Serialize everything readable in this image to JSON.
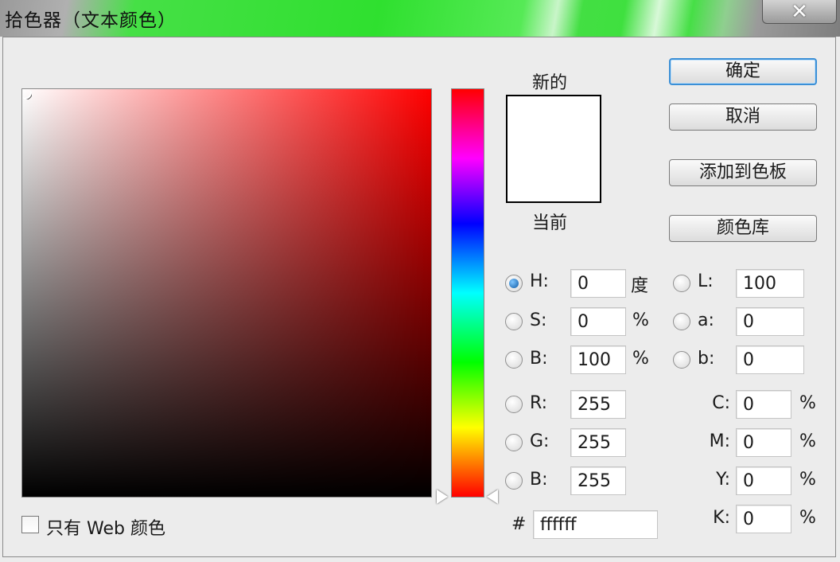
{
  "window": {
    "title": "拾色器（文本颜色）",
    "close_glyph": "✕"
  },
  "swatch": {
    "new_label": "新的",
    "current_label": "当前",
    "new_color": "#ffffff",
    "current_color": "#ffffff"
  },
  "buttons": {
    "ok": "确定",
    "cancel": "取消",
    "add_to_swatches": "添加到色板",
    "color_libraries": "颜色库"
  },
  "hsb": {
    "h": {
      "label": "H:",
      "value": "0",
      "unit": "度",
      "selected": true
    },
    "s": {
      "label": "S:",
      "value": "0",
      "unit": "%"
    },
    "b": {
      "label": "B:",
      "value": "100",
      "unit": "%"
    }
  },
  "rgb": {
    "r": {
      "label": "R:",
      "value": "255"
    },
    "g": {
      "label": "G:",
      "value": "255"
    },
    "b": {
      "label": "B:",
      "value": "255"
    }
  },
  "lab": {
    "l": {
      "label": "L:",
      "value": "100"
    },
    "a": {
      "label": "a:",
      "value": "0"
    },
    "b": {
      "label": "b:",
      "value": "0"
    }
  },
  "cmyk": {
    "c": {
      "label": "C:",
      "value": "0",
      "unit": "%"
    },
    "m": {
      "label": "M:",
      "value": "0",
      "unit": "%"
    },
    "y": {
      "label": "Y:",
      "value": "0",
      "unit": "%"
    },
    "k": {
      "label": "K:",
      "value": "0",
      "unit": "%"
    }
  },
  "hex": {
    "label": "#",
    "value": "ffffff"
  },
  "web_only": {
    "label": "只有 Web 颜色",
    "checked": false
  },
  "colors": {
    "accent": "#3b8fd6",
    "title_bar": "#2fe02f",
    "hue_selected": "#ff0000"
  }
}
